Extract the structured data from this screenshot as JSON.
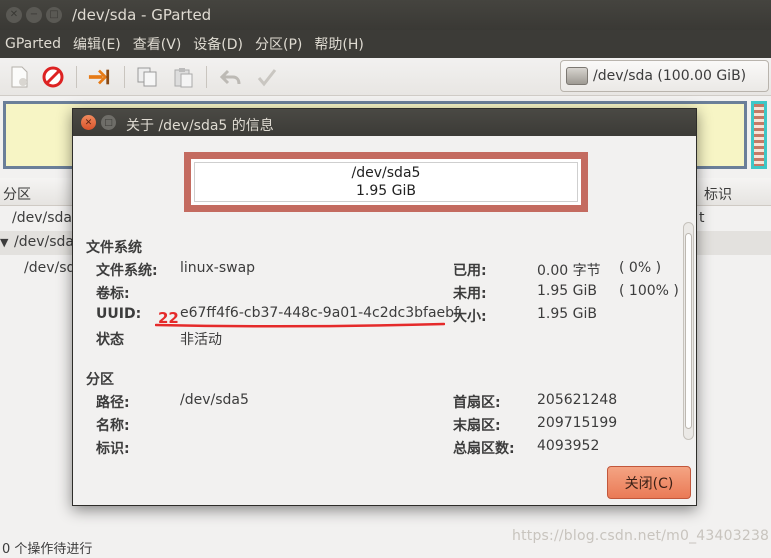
{
  "window": {
    "title": "/dev/sda - GParted",
    "menu": [
      "GParted",
      "编辑(E)",
      "查看(V)",
      "设备(D)",
      "分区(P)",
      "帮助(H)"
    ],
    "device_selector": "/dev/sda  (100.00 GiB)"
  },
  "toolbar_icons": [
    "new-icon",
    "delete-icon",
    "resize-move-icon",
    "copy-icon",
    "paste-icon",
    "undo-icon",
    "apply-icon"
  ],
  "partition_list": {
    "headers": {
      "partition": "分区",
      "flags": "标识"
    },
    "rows": [
      {
        "name": "/dev/sda",
        "tail": "t"
      },
      {
        "name": "/dev/sda",
        "tail": ""
      },
      {
        "name": "/dev/sd",
        "tail": ""
      }
    ]
  },
  "status_bar": "0 个操作待进行",
  "dialog": {
    "title": "关于 /dev/sda5 的信息",
    "partition_name": "/dev/sda5",
    "partition_size": "1.95 GiB",
    "filesystem_section": "文件系统",
    "filesystem": {
      "fs_label": "文件系统:",
      "fs_value": "linux-swap",
      "label_label": "卷标:",
      "label_value": "",
      "uuid_label": "UUID:",
      "uuid_value": "e67ff4f6-cb37-448c-9a01-4c2dc3bfaebf",
      "state_label": "状态",
      "state_value": "非活动",
      "used_label": "已用:",
      "used_value": "0.00 字节",
      "used_pct": "( 0% )",
      "unused_label": "未用:",
      "unused_value": "1.95 GiB",
      "unused_pct": "( 100% )",
      "size_label": "大小:",
      "size_value": "1.95 GiB"
    },
    "partition_section": "分区",
    "partition": {
      "path_label": "路径:",
      "path_value": "/dev/sda5",
      "name_label": "名称:",
      "name_value": "",
      "flags_label": "标识:",
      "flags_value": "",
      "first_sector_label": "首扇区:",
      "first_sector_value": "205621248",
      "last_sector_label": "末扇区:",
      "last_sector_value": "209715199",
      "total_sectors_label": "总扇区数:",
      "total_sectors_value": "4093952"
    },
    "close_button": "关闭(C)"
  },
  "annotation": {
    "number": "22",
    "color": "#e52a2a"
  },
  "watermark": "https://blog.csdn.net/m0_43403238"
}
